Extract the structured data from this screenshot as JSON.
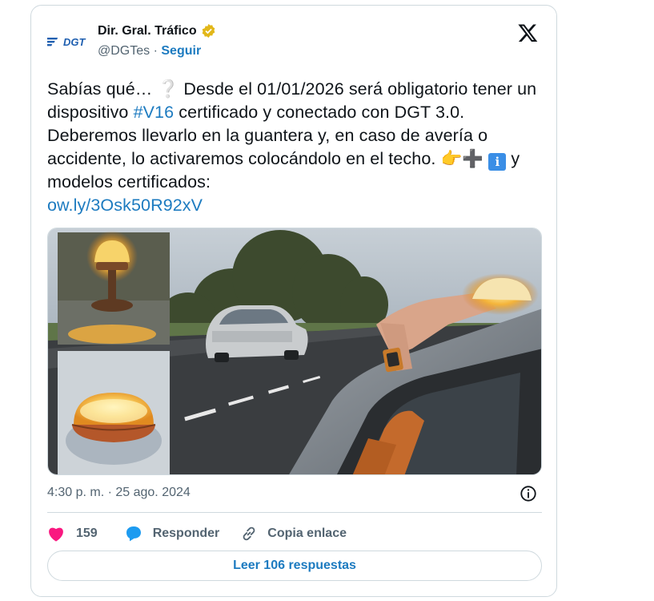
{
  "tweet": {
    "author": {
      "name": "Dir. Gral. Tráfico",
      "handle": "@DGTes",
      "separator": "·",
      "follow_label": "Seguir",
      "logo_text": "DGT"
    },
    "text_parts": {
      "p1": "Sabías qué… ",
      "emoji_question": "❔",
      "p2": " Desde el 01/01/2026 será obligatorio tener un dispositivo ",
      "hashtag": "#V16",
      "p3": " certificado y conectado con DGT 3.0. Deberemos llevarlo en la guantera y, en caso de avería o accidente, lo activaremos colocándolo en el techo. ",
      "emoji_hand": "👉",
      "emoji_plus": "➕",
      "emoji_info": "i",
      "p4": " y modelos certificados:",
      "link": "ow.ly/3Osk50R92xV"
    },
    "timestamp": "4:30 p. m. · 25 ago. 2024",
    "likes": "159",
    "reply_label": "Responder",
    "copy_label": "Copia enlace",
    "read_replies_label": "Leer 106 respuestas"
  },
  "colors": {
    "accent": "#1d7bc0",
    "like": "#f91880",
    "verified_badge": "#e2b719",
    "text_secondary": "#536471",
    "border": "#cfd9de"
  },
  "icons": [
    "dgt-logo-icon",
    "verified-badge-icon",
    "x-logo-icon",
    "info-icon",
    "heart-icon",
    "reply-bubble-icon",
    "link-icon"
  ]
}
